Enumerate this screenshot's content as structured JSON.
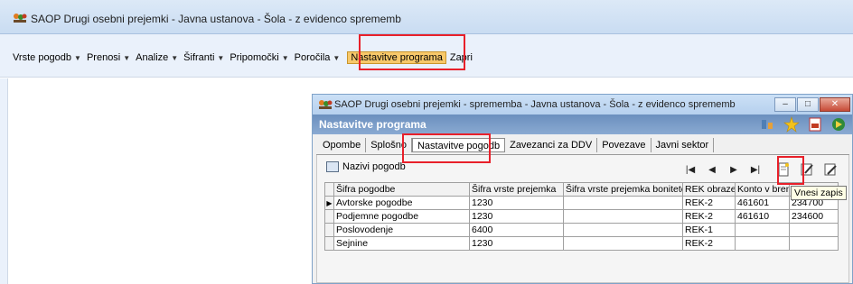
{
  "app": {
    "title": "SAOP Drugi osebni prejemki - Javna ustanova - Šola - z evidenco sprememb"
  },
  "menu": {
    "items": [
      {
        "label": "Vrste pogodb",
        "dropdown": true
      },
      {
        "label": "Prenosi",
        "dropdown": true
      },
      {
        "label": "Analize",
        "dropdown": true
      },
      {
        "label": "Šifranti",
        "dropdown": true
      },
      {
        "label": "Pripomočki",
        "dropdown": true
      },
      {
        "label": "Poročila",
        "dropdown": true
      },
      {
        "label": "Nastavitve programa",
        "dropdown": false,
        "active": true
      },
      {
        "label": "Zapri",
        "dropdown": false
      }
    ]
  },
  "subwindow": {
    "title": "SAOP  Drugi osebni prejemki  - sprememba - Javna ustanova - Šola - z evidenco sprememb",
    "header": "Nastavitve programa",
    "tabs": [
      "Opombe",
      "Splošno",
      "Nastavitve pogodb",
      "Zavezanci za DDV",
      "Povezave",
      "Javni sektor"
    ],
    "selected_tab": "Nastavitve pogodb",
    "toolbar": {
      "names_button": "Nazivi pogodb",
      "nav": [
        "first",
        "prev",
        "next",
        "last"
      ],
      "tools": [
        "new-record",
        "edit",
        "edit-other"
      ]
    },
    "tooltip": "Vnesi zapis",
    "grid": {
      "columns": [
        "Šifra pogodbe",
        "Šifra vrste prejemka",
        "Šifra vrste prejemka bonitete",
        "REK obrazec",
        "Konto v breme",
        ""
      ],
      "rows": [
        [
          "Avtorske pogodbe",
          "1230",
          "",
          "REK-2",
          "461601",
          "234700"
        ],
        [
          "Podjemne pogodbe",
          "1230",
          "",
          "REK-2",
          "461610",
          "234600"
        ],
        [
          "Poslovodenje",
          "6400",
          "",
          "REK-1",
          "",
          ""
        ],
        [
          "Sejnine",
          "1230",
          "",
          "REK-2",
          "",
          ""
        ]
      ]
    }
  },
  "colors": {
    "highlight": "#e8202a",
    "active_menu": "#f7c86a",
    "header_bg": "#6b8fbe"
  }
}
